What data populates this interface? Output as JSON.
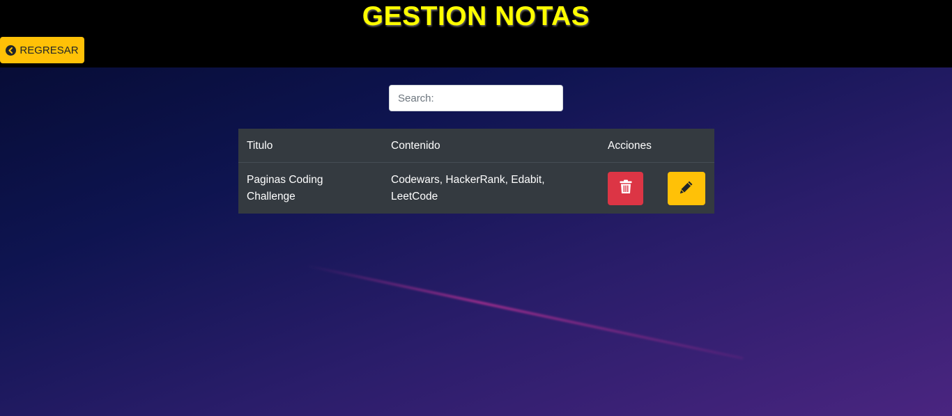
{
  "header": {
    "title": "GESTION NOTAS",
    "back_button_label": "REGRESAR"
  },
  "search": {
    "placeholder": "Search:",
    "value": ""
  },
  "table": {
    "columns": [
      "Titulo",
      "Contenido",
      "Acciones"
    ],
    "rows": [
      {
        "titulo_line1": "Paginas Coding",
        "titulo_line2": "Challenge",
        "contenido_line1": "Codewars, HackerRank, Edabit,",
        "contenido_line2": "LeetCode"
      }
    ]
  },
  "icons": {
    "back": "arrow-circle-left-icon",
    "delete": "trash-icon",
    "edit": "pencil-icon"
  },
  "colors": {
    "title": "#ffff00",
    "accent": "#ffc107",
    "danger": "#dc3545",
    "table_bg": "#343a40"
  }
}
